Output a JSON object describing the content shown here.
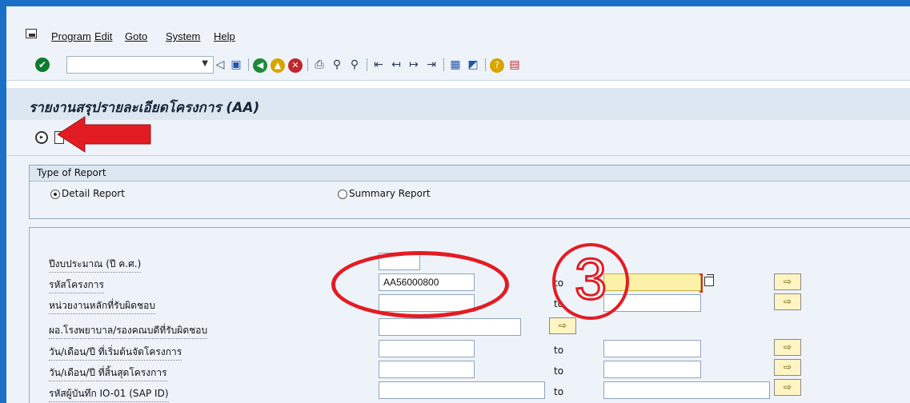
{
  "menu": {
    "items": [
      "Program",
      "Edit",
      "Goto",
      "System",
      "Help"
    ]
  },
  "toolbar": {
    "command_value": "",
    "icons": [
      "enter-icon",
      "back-icon",
      "save-icon",
      "back-green-icon",
      "exit-icon",
      "cancel-icon",
      "print-icon",
      "find-icon",
      "find-next-icon",
      "first-page-icon",
      "previous-page-icon",
      "next-page-icon",
      "last-page-icon",
      "create-session-icon",
      "shortcut-icon",
      "help-icon",
      "customize-layout-icon"
    ]
  },
  "title": "รายงานสรุปรายละเอียดโครงการ (AA)",
  "report_type": {
    "group_title": "Type of Report",
    "options": [
      {
        "label": "Detail Report",
        "selected": true
      },
      {
        "label": "Summary Report",
        "selected": false
      }
    ]
  },
  "selection": {
    "fields": [
      {
        "label": "ปีงบประมาณ (ปี ค.ศ.)",
        "from": ""
      },
      {
        "label": "รหัสโครงการ",
        "from": "AA56000800",
        "to_label": "to",
        "to": ""
      },
      {
        "label": "หน่วยงานหลักที่รับผิดชอบ",
        "from": "",
        "to_label": "to",
        "to": ""
      },
      {
        "label": "ผอ.โรงพยาบาล/รองคณบดีที่รับผิดชอบ",
        "from": ""
      },
      {
        "label": "วัน/เดือน/ปี ที่เริ่มต้นจัดโครงการ",
        "from": "",
        "to_label": "to",
        "to": ""
      },
      {
        "label": "วัน/เดือน/ปี ที่สิ้นสุดโครงการ",
        "from": "",
        "to_label": "to",
        "to": ""
      },
      {
        "label": "รหัสผู้บันทึก IO-01 (SAP ID)",
        "from": "",
        "to_label": "to",
        "to": ""
      }
    ]
  },
  "annotation": {
    "step_number": "3",
    "color": "#e31c24"
  },
  "colors": {
    "frame": "#1a70c7",
    "background": "#eef3f9",
    "title_bg": "#dde7f2",
    "required_field": "#fdf0a8"
  }
}
